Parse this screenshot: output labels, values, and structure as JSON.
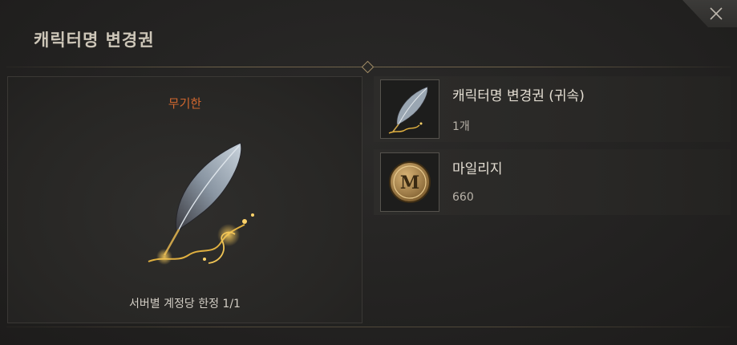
{
  "dialog": {
    "title": "캐릭터명 변경권"
  },
  "preview": {
    "rarity": "무기한",
    "purchase_limit": "서버별 계정당 한정 1/1",
    "item_icon": "quill-feather-icon",
    "rarity_color": "#d0672f"
  },
  "items": [
    {
      "name": "캐릭터명 변경권 (귀속)",
      "count": "1개",
      "icon": "quill-feather-icon"
    },
    {
      "name": "마일리지",
      "count": "660",
      "icon": "mileage-coin-icon",
      "coin_letter": "M"
    }
  ],
  "colors": {
    "background": "#232222",
    "accent_gold": "#a58f68"
  }
}
